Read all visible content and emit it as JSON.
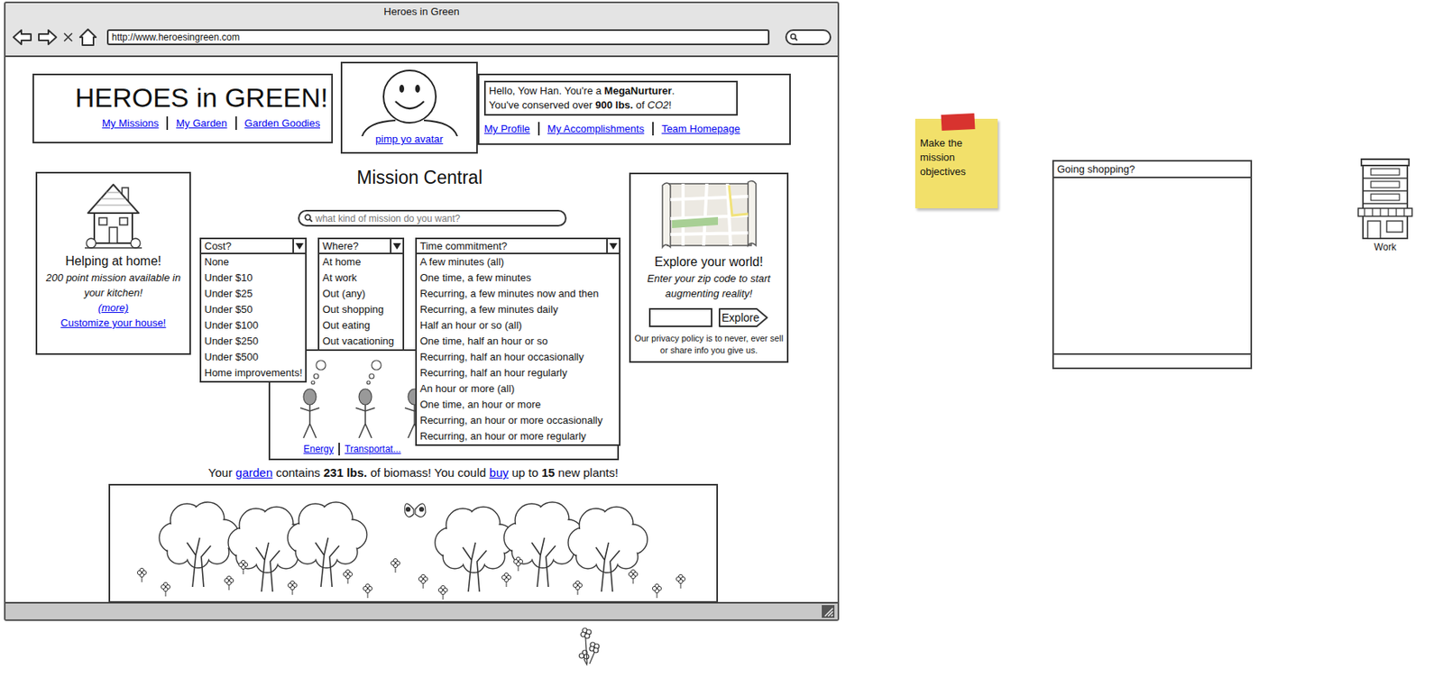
{
  "window": {
    "title": "Heroes in Green"
  },
  "address_bar": {
    "url": "http://www.heroesingreen.com"
  },
  "header": {
    "logo": "HEROES in GREEN!",
    "links": [
      "My Missions",
      "My Garden",
      "Garden Goodies"
    ],
    "avatar_link": "pimp yo avatar",
    "greeting": [
      {
        "segments": [
          {
            "text": "Hello, Yow Han. You're a ",
            "kind": "plain"
          },
          {
            "text": "MegaNurturer",
            "kind": "bold"
          },
          {
            "text": ".",
            "kind": "plain"
          }
        ]
      },
      {
        "segments": [
          {
            "text": "You've conserved over ",
            "kind": "plain"
          },
          {
            "text": "900 lbs.",
            "kind": "bold"
          },
          {
            "text": " of ",
            "kind": "plain"
          },
          {
            "text": "CO2",
            "kind": "italic"
          },
          {
            "text": "!",
            "kind": "plain"
          }
        ]
      }
    ],
    "profile_links": [
      "My Profile",
      "My Accomplishments",
      "Team Homepage"
    ]
  },
  "home_panel": {
    "title": "Helping at home!",
    "text": "200 point mission available in your kitchen!",
    "more": "(more)",
    "link": "Customize your house!"
  },
  "mission_central": {
    "title": "Mission Central",
    "search": {
      "placeholder": "what kind of mission do you want?"
    },
    "filters": [
      {
        "label": "Cost?",
        "expanded": true,
        "options": [
          "None",
          "Under $10",
          "Under $25",
          "Under $50",
          "Under $100",
          "Under $250",
          "Under $500",
          "Home improvements!"
        ]
      },
      {
        "label": "Where?",
        "expanded": true,
        "options": [
          "At home",
          "At work",
          "Out (any)",
          "Out shopping",
          "Out eating",
          "Out vacationing"
        ]
      },
      {
        "label": "Time commitment?",
        "expanded": true,
        "options": [
          "A few minutes (all)",
          "One time, a few minutes",
          "Recurring, a few minutes now and then",
          "Recurring, a few minutes daily",
          "Half an hour or so (all)",
          "One time, half an hour or so",
          "Recurring, half an hour occasionally",
          "Recurring, half an hour regularly",
          "An hour or more (all)",
          "One time, an hour or more",
          "Recurring, an hour or more occasionally",
          "Recurring, an hour or more regularly"
        ]
      }
    ],
    "categories": [
      "Energy",
      "Transportat..."
    ]
  },
  "explore_panel": {
    "title": "Explore your world!",
    "text": "Enter your zip code to start augmenting reality!",
    "button": "Explore",
    "privacy": "Our privacy policy is to never, ever sell or share info you give us."
  },
  "garden": {
    "summary": [
      {
        "text": "Your ",
        "kind": "plain"
      },
      {
        "text": "garden",
        "kind": "link"
      },
      {
        "text": " contains ",
        "kind": "plain"
      },
      {
        "text": "231 lbs.",
        "kind": "bold"
      },
      {
        "text": " of biomass! You could ",
        "kind": "plain"
      },
      {
        "text": "buy",
        "kind": "link"
      },
      {
        "text": " up to ",
        "kind": "plain"
      },
      {
        "text": "15",
        "kind": "bold"
      },
      {
        "text": " new plants!",
        "kind": "plain"
      }
    ]
  },
  "canvas": {
    "sticky_note": "Make the mission objectives",
    "panel": {
      "title": "Going shopping?"
    },
    "store_label": "Work"
  }
}
